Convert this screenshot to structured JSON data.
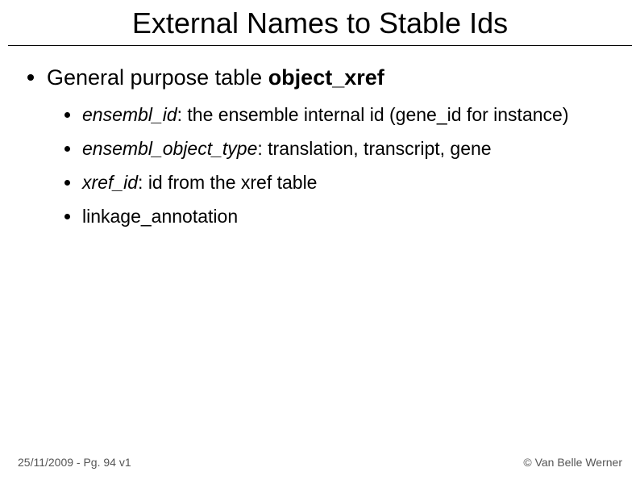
{
  "title": "External Names to Stable Ids",
  "main": {
    "intro_prefix": "General purpose table ",
    "intro_bold": "object_xref",
    "items": [
      {
        "term": "ensembl_id",
        "desc": ": the ensemble internal id (gene_id for instance)"
      },
      {
        "term": "ensembl_object_type",
        "desc": ": translation, transcript, gene"
      },
      {
        "term": "xref_id",
        "desc": ": id from the xref table"
      },
      {
        "term": "",
        "desc": "linkage_annotation"
      }
    ]
  },
  "footer": {
    "left": "25/11/2009 - Pg. 94 v1",
    "right": "© Van Belle Werner"
  }
}
